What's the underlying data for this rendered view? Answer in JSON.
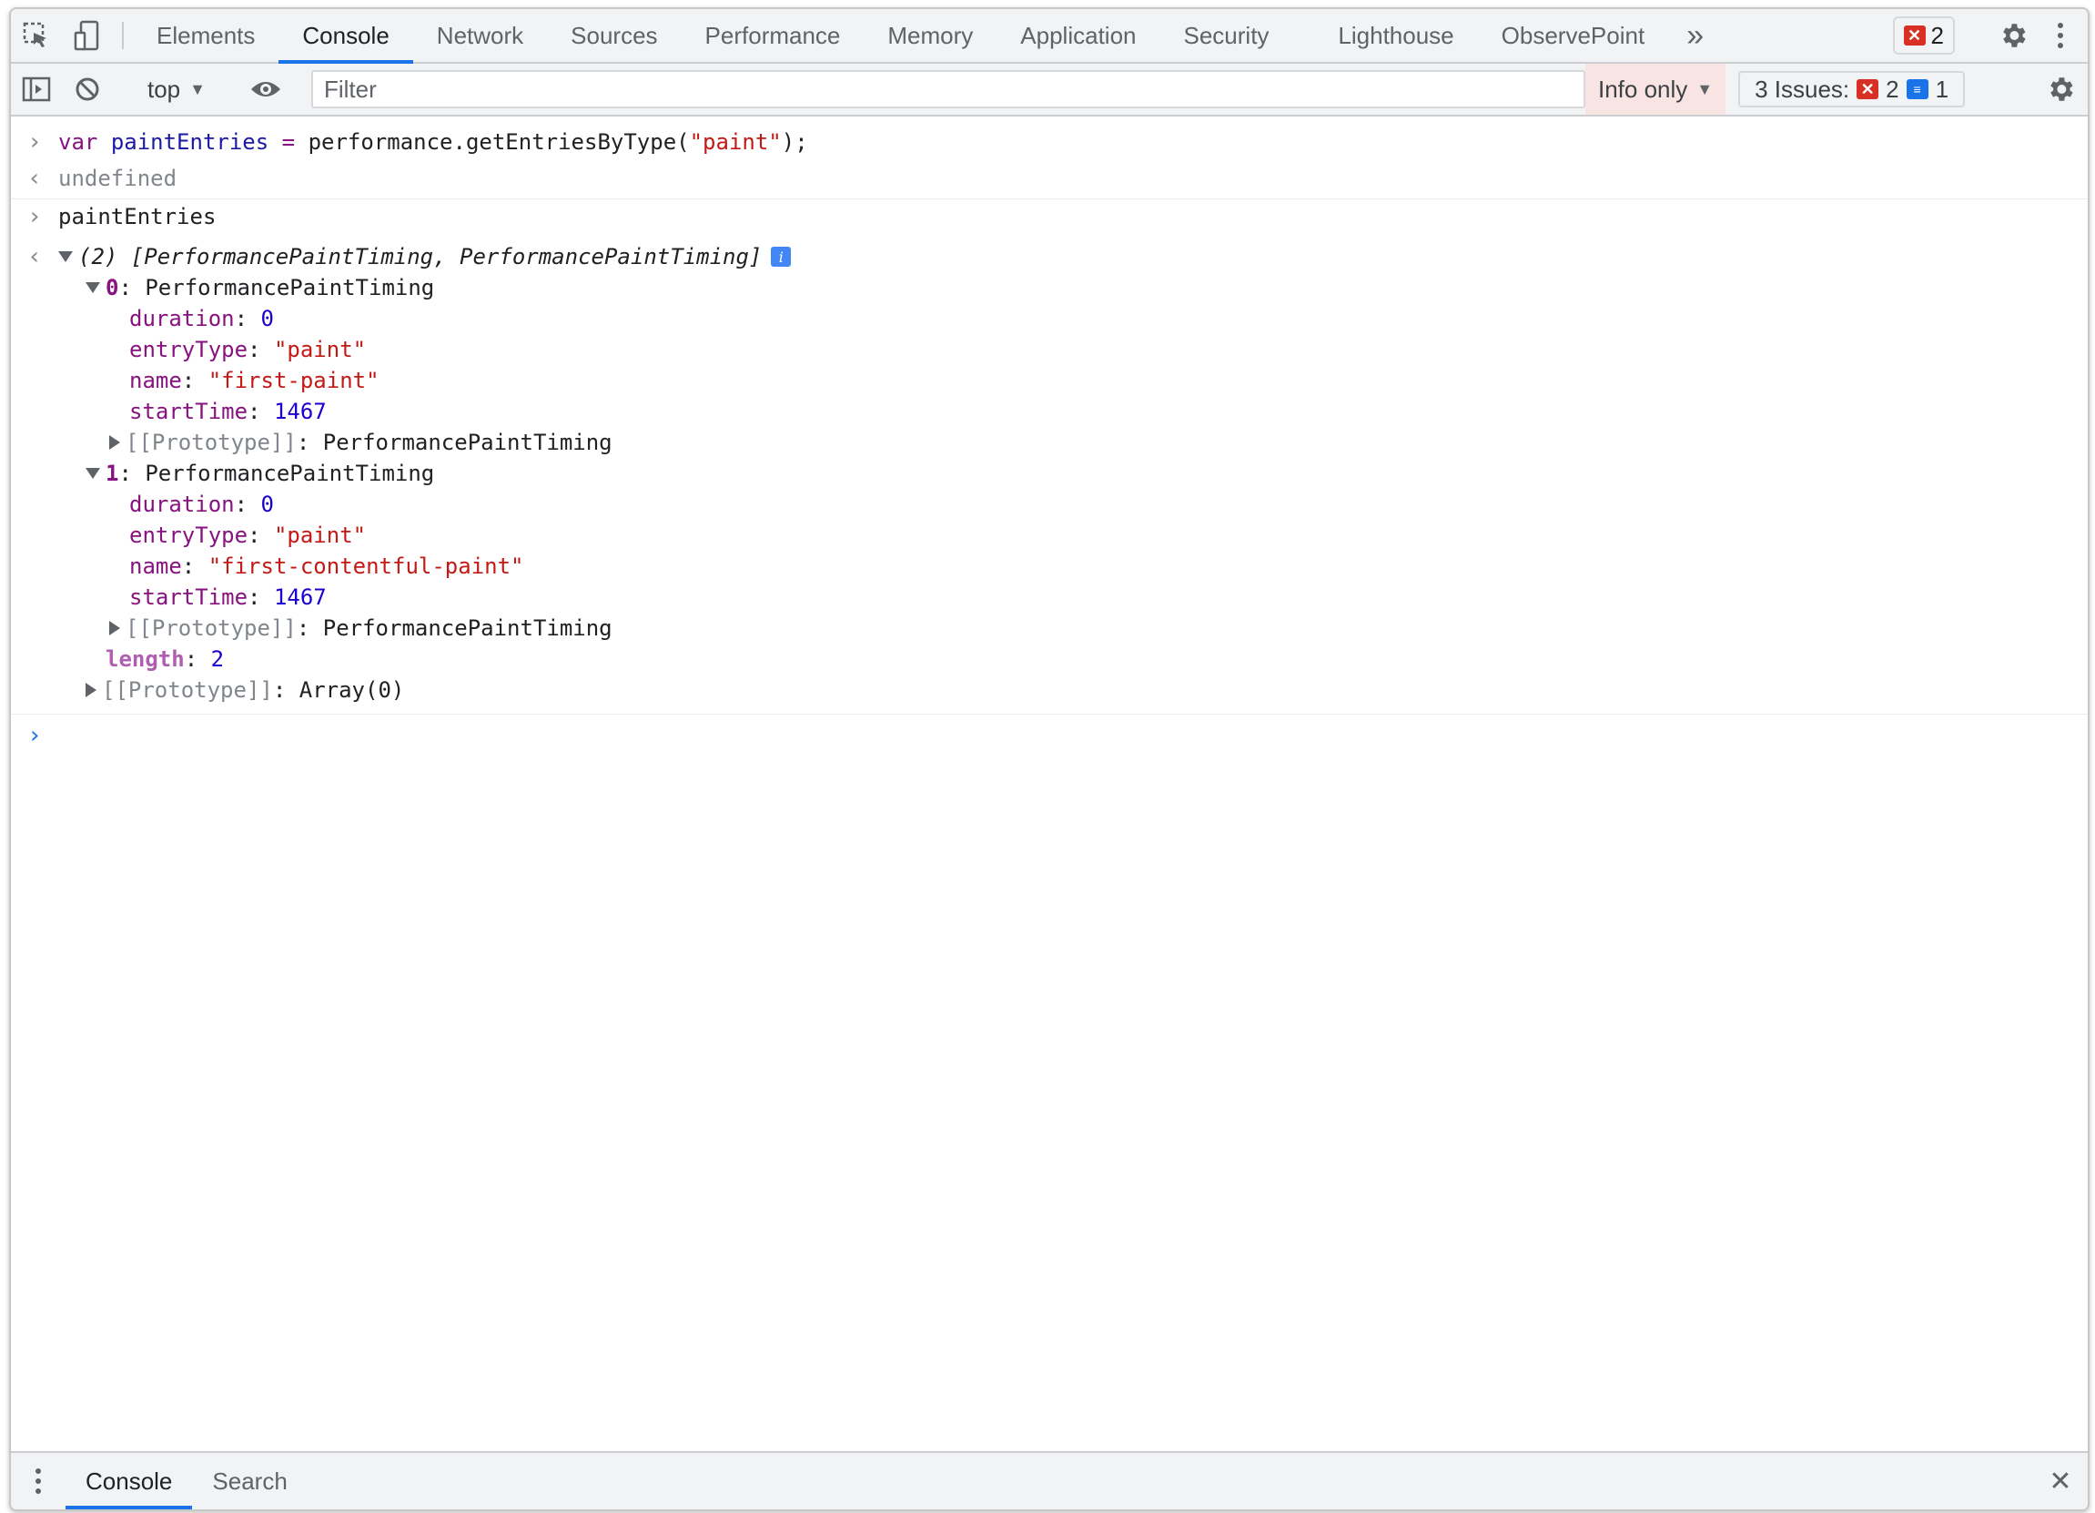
{
  "tabbar": {
    "tabs": [
      "Elements",
      "Console",
      "Network",
      "Sources",
      "Performance",
      "Memory",
      "Application",
      "Security",
      "Lighthouse",
      "ObservePoint"
    ],
    "active_tab": "Console",
    "more": "»",
    "error_count": "2"
  },
  "toolbar": {
    "context": "top",
    "filter_placeholder": "Filter",
    "levels": "Info only",
    "issues_label": "3 Issues:",
    "issues_errors": "2",
    "issues_messages": "1"
  },
  "console": {
    "l1_kw": "var",
    "l1_var": "paintEntries",
    "l1_eq": " = ",
    "l1_call": "performance.getEntriesByType(",
    "l1_str": "\"paint\"",
    "l1_end": ");",
    "l2": "undefined",
    "l3": "paintEntries",
    "l4_summary": "(2) [PerformancePaintTiming, PerformancePaintTiming]",
    "e0_index": "0",
    "e0_type": "PerformancePaintTiming",
    "e0_duration_key": "duration",
    "e0_duration_val": "0",
    "e0_entrytype_key": "entryType",
    "e0_entrytype_val": "\"paint\"",
    "e0_name_key": "name",
    "e0_name_val": "\"first-paint\"",
    "e0_start_key": "startTime",
    "e0_start_val": "1467",
    "e0_proto_key": "[[Prototype]]",
    "e0_proto_val": "PerformancePaintTiming",
    "e1_index": "1",
    "e1_type": "PerformancePaintTiming",
    "e1_duration_key": "duration",
    "e1_duration_val": "0",
    "e1_entrytype_key": "entryType",
    "e1_entrytype_val": "\"paint\"",
    "e1_name_key": "name",
    "e1_name_val": "\"first-contentful-paint\"",
    "e1_start_key": "startTime",
    "e1_start_val": "1467",
    "e1_proto_key": "[[Prototype]]",
    "e1_proto_val": "PerformancePaintTiming",
    "length_key": "length",
    "length_val": "2",
    "arr_proto_key": "[[Prototype]]",
    "arr_proto_val": "Array(0)"
  },
  "drawer": {
    "tabs": [
      "Console",
      "Search"
    ]
  }
}
